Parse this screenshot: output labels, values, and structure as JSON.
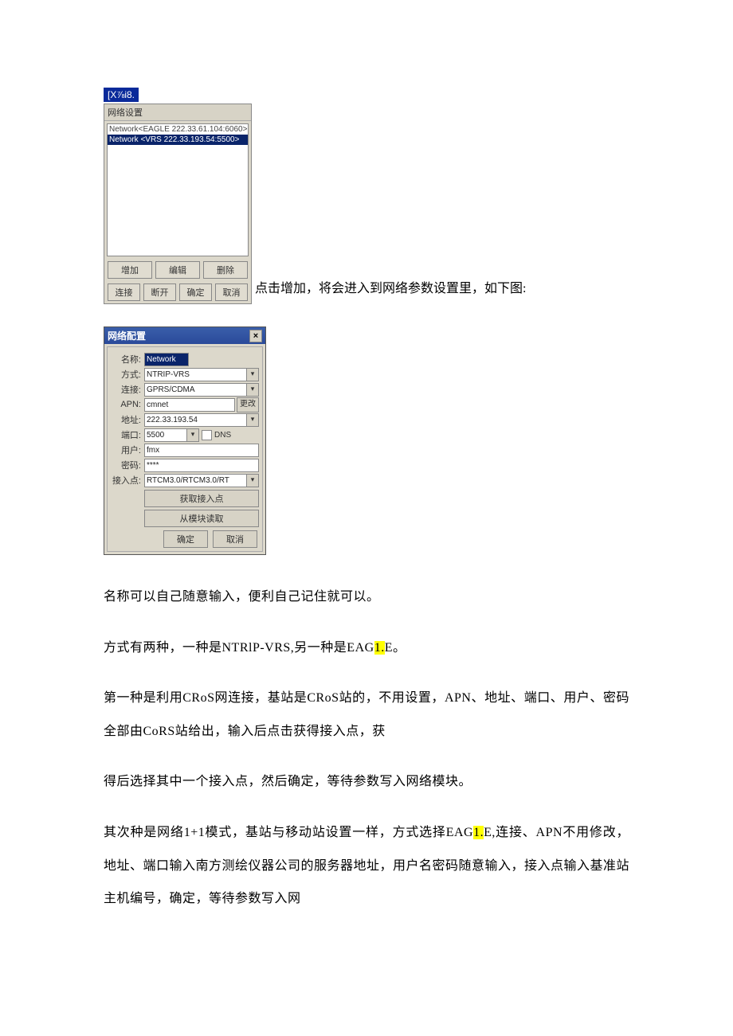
{
  "badge": "[X⅞i8.",
  "win1": {
    "title": "网络设置",
    "items": [
      "Network<EAGLE 222.33.61.104:6060>",
      "Network <VRS  222.33.193.54:5500>"
    ],
    "row1": [
      "增加",
      "编辑",
      "删除"
    ],
    "row2": [
      "连接",
      "断开",
      "确定",
      "取消"
    ]
  },
  "inline_after_win1": "点击增加，将会进入到网络参数设置里，如下图:",
  "win2": {
    "title": "网络配置",
    "rows": {
      "name_lbl": "名称:",
      "name_val": "Network",
      "mode_lbl": "方式:",
      "mode_val": "NTRIP-VRS",
      "conn_lbl": "连接:",
      "conn_val": "GPRS/CDMA",
      "apn_lbl": "APN:",
      "apn_val": "cmnet",
      "apn_btn": "更改",
      "addr_lbl": "地址:",
      "addr_val": "222.33.193.54",
      "port_lbl": "端口:",
      "port_val": "5500",
      "dns_lbl": "DNS",
      "user_lbl": "用户:",
      "user_val": "fmx",
      "pwd_lbl": "密码:",
      "pwd_val": "****",
      "ap_lbl": "接入点:",
      "ap_val": "RTCM3.0/RTCM3.0/RT"
    },
    "get_ap_btn": "获取接入点",
    "read_btn": "从模块读取",
    "ok_btn": "确定",
    "cancel_btn": "取消"
  },
  "p1": "名称可以自己随意输入，便利自己记住就可以。",
  "p2a": "方式有两种，一种是NTRlP-VRS,另一种是EAG",
  "p2hl": "1.",
  "p2b": "E。",
  "p3": "第一种是利用CRoS网连接，基站是CRoS站的，不用设置，APN、地址、端口、用户、密码全部由CoRS站给出，输入后点击获得接入点，获",
  "p4": "得后选择其中一个接入点，然后确定，等待参数写入网络模块。",
  "p5a": "其次种是网络1+1模式，基站与移动站设置一样，方式选择EAG",
  "p5hl": "1.",
  "p5b": "E,连接、APN不用修改，地址、端口输入南方测绘仪器公司的服务器地址，用户名密码随意输入，接入点输入基准站主机编号，确定，等待参数写入网"
}
